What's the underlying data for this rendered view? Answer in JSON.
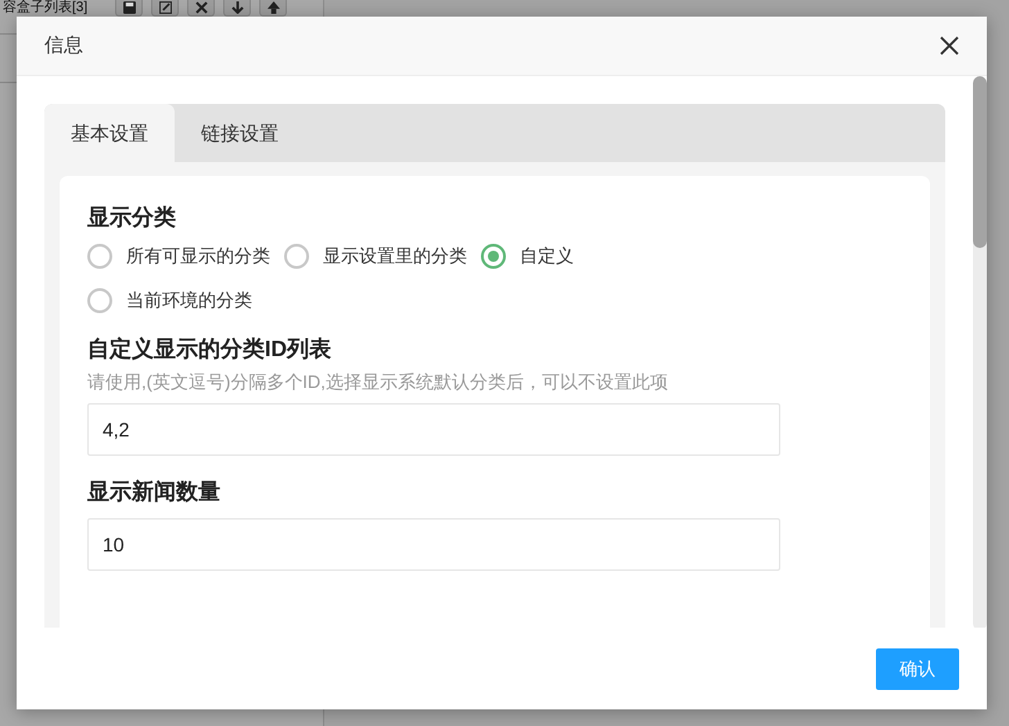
{
  "background_page": {
    "list_title": "容盒子列表[3]",
    "toolbar": [
      {
        "kind": "save"
      },
      {
        "kind": "edit"
      },
      {
        "kind": "delete"
      },
      {
        "kind": "down"
      },
      {
        "kind": "up"
      }
    ]
  },
  "dialog": {
    "title": "信息",
    "tabs": [
      {
        "label": "基本设置",
        "selected": true
      },
      {
        "label": "链接设置",
        "selected": false
      }
    ],
    "sections": [
      {
        "kind": "radio",
        "label": "显示分类",
        "options": [
          {
            "label": "所有可显示的分类",
            "selected": false
          },
          {
            "label": "显示设置里的分类",
            "selected": false
          },
          {
            "label": "自定义",
            "selected": true
          },
          {
            "label": "当前环境的分类",
            "selected": false
          }
        ]
      },
      {
        "kind": "text",
        "label": "自定义显示的分类ID列表",
        "hint": "请使用,(英文逗号)分隔多个ID,选择显示系统默认分类后，可以不设置此项",
        "value": "4,2"
      },
      {
        "kind": "text",
        "label": "显示新闻数量",
        "value": "10"
      }
    ],
    "buttons": [
      "确认"
    ]
  }
}
